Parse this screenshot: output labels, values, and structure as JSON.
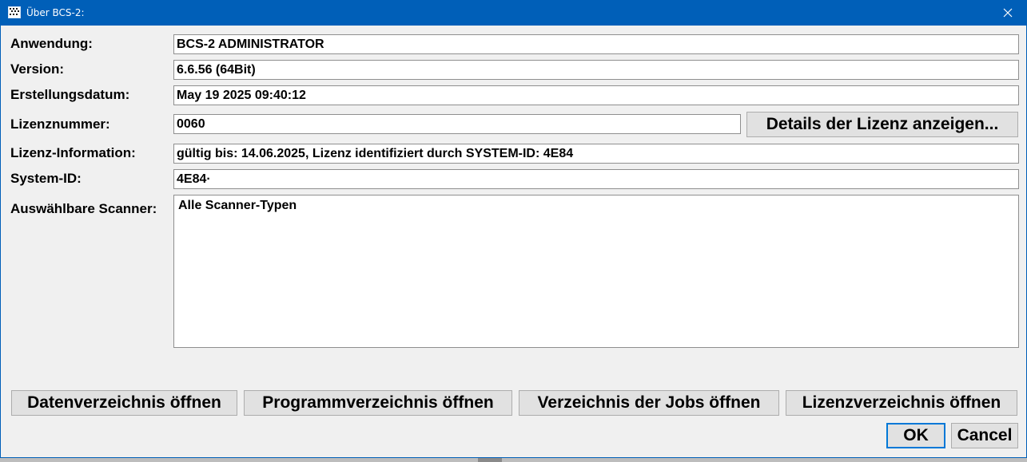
{
  "window": {
    "title": "Über BCS-2:"
  },
  "fields": {
    "anwendung": {
      "label": "Anwendung:",
      "value": "BCS-2 ADMINISTRATOR"
    },
    "version": {
      "label": "Version:",
      "value": "6.6.56 (64Bit)"
    },
    "erstellungsdatum": {
      "label": "Erstellungsdatum:",
      "value": "May 19 2025 09:40:12"
    },
    "lizenznummer": {
      "label": "Lizenznummer:",
      "value": "0060"
    },
    "lizenz_information": {
      "label": "Lizenz-Information:",
      "value": "gültig bis: 14.06.2025, Lizenz identifiziert durch SYSTEM-ID: 4E84"
    },
    "system_id": {
      "label": "System-ID:",
      "value": "4E84·"
    },
    "scanner": {
      "label": "Auswählbare Scanner:",
      "value": "Alle Scanner-Typen"
    }
  },
  "buttons": {
    "details_lizenz": "Details der Lizenz anzeigen...",
    "datenverzeichnis": "Datenverzeichnis öffnen",
    "programmverzeichnis": "Programmverzeichnis öffnen",
    "jobs_verzeichnis": "Verzeichnis der Jobs öffnen",
    "lizenzverzeichnis": "Lizenzverzeichnis öffnen",
    "ok": "OK",
    "cancel": "Cancel"
  },
  "colors": {
    "titlebar": "#005fb8",
    "dialog_bg": "#f0f0f0",
    "default_button_border": "#0078d7"
  },
  "icons": {
    "app": "app-icon",
    "close": "close-icon"
  }
}
